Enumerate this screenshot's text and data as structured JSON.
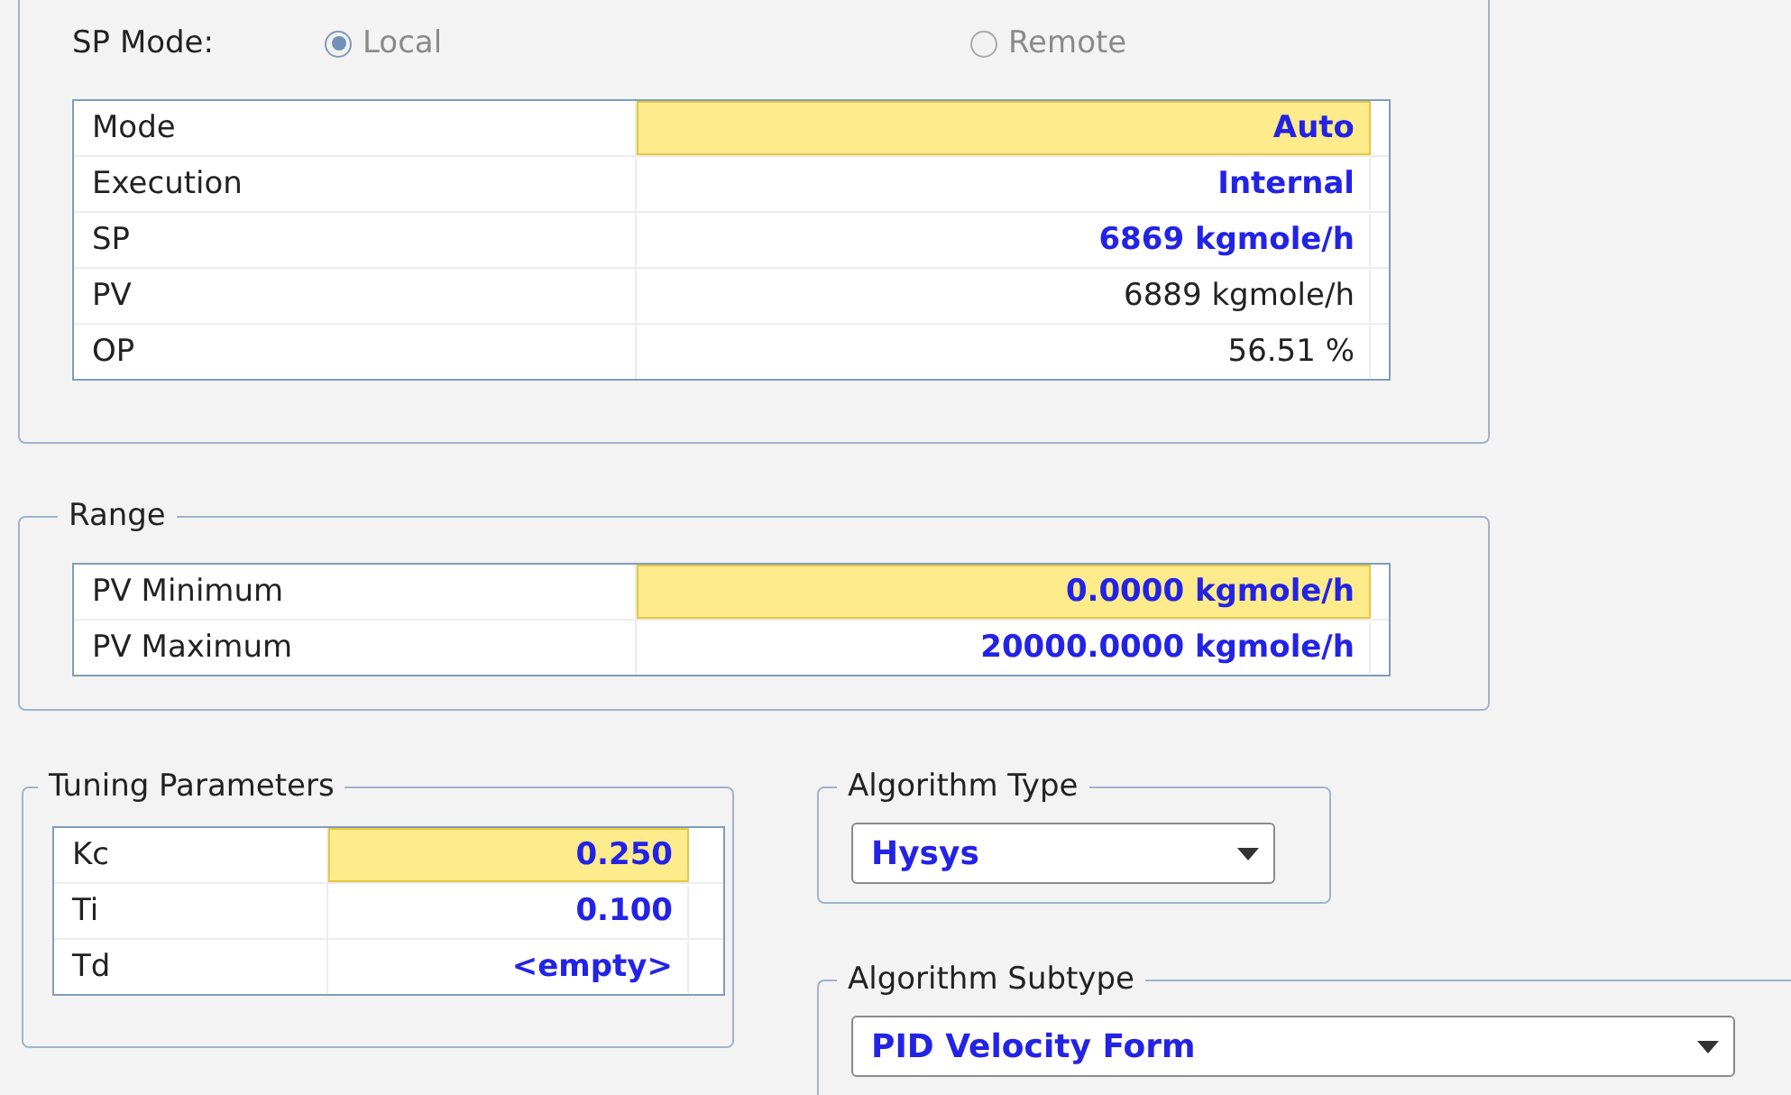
{
  "sp_mode": {
    "label": "SP Mode:",
    "disabled": true,
    "options": [
      {
        "label": "Local",
        "selected": true
      },
      {
        "label": "Remote",
        "selected": false
      }
    ]
  },
  "status_table": {
    "rows": [
      {
        "label": "Mode",
        "value": "Auto",
        "highlighted": true,
        "editable": true
      },
      {
        "label": "Execution",
        "value": "Internal",
        "highlighted": false,
        "editable": true
      },
      {
        "label": "SP",
        "value": "6869 kgmole/h",
        "highlighted": false,
        "editable": true
      },
      {
        "label": "PV",
        "value": "6889 kgmole/h",
        "highlighted": false,
        "editable": false
      },
      {
        "label": "OP",
        "value": "56.51 %",
        "highlighted": false,
        "editable": false
      }
    ]
  },
  "range": {
    "title": "Range",
    "rows": [
      {
        "label": "PV Minimum",
        "value": "0.0000 kgmole/h",
        "highlighted": true,
        "editable": true
      },
      {
        "label": "PV Maximum",
        "value": "20000.0000 kgmole/h",
        "highlighted": false,
        "editable": true
      }
    ]
  },
  "tuning": {
    "title": "Tuning Parameters",
    "rows": [
      {
        "label": "Kc",
        "value": "0.250",
        "highlighted": true,
        "editable": true
      },
      {
        "label": "Ti",
        "value": "0.100",
        "highlighted": false,
        "editable": true
      },
      {
        "label": "Td",
        "value": "<empty>",
        "highlighted": false,
        "editable": true
      }
    ]
  },
  "algorithm_type": {
    "title": "Algorithm Type",
    "value": "Hysys"
  },
  "algorithm_subtype": {
    "title": "Algorithm Subtype",
    "value": "PID Velocity Form"
  }
}
